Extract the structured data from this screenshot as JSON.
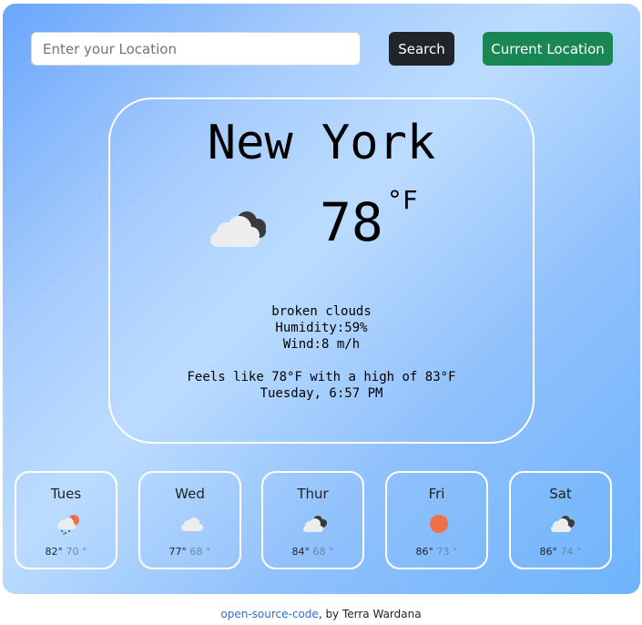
{
  "search": {
    "placeholder": "Enter your Location",
    "value": ""
  },
  "buttons": {
    "search": "Search",
    "current_location": "Current Location"
  },
  "current": {
    "city": "New York",
    "temp": "78",
    "unit": "°F",
    "icon": "broken-clouds-icon",
    "description": "broken clouds",
    "humidity": "Humidity:59%",
    "wind": "Wind:8 m/h",
    "feels_like": "Feels like 78°F with a high of 83°F",
    "datetime": "Tuesday, 6:57 PM"
  },
  "forecast": [
    {
      "day": "Tues",
      "icon": "rain-cloud-icon",
      "high": "82°",
      "low": "70 °"
    },
    {
      "day": "Wed",
      "icon": "cloud-icon",
      "high": "77°",
      "low": "68 °"
    },
    {
      "day": "Thur",
      "icon": "broken-clouds-icon",
      "high": "84°",
      "low": "68 °"
    },
    {
      "day": "Fri",
      "icon": "sun-icon",
      "high": "86°",
      "low": "73 °"
    },
    {
      "day": "Sat",
      "icon": "broken-clouds-icon",
      "high": "86°",
      "low": "74 °"
    }
  ],
  "footer": {
    "link": "open-source-code",
    "text": ", by Terra Wardana"
  },
  "colors": {
    "search_button": "#212529",
    "location_button": "#198754",
    "sun": "#f07048",
    "link": "#2e6fd6"
  }
}
